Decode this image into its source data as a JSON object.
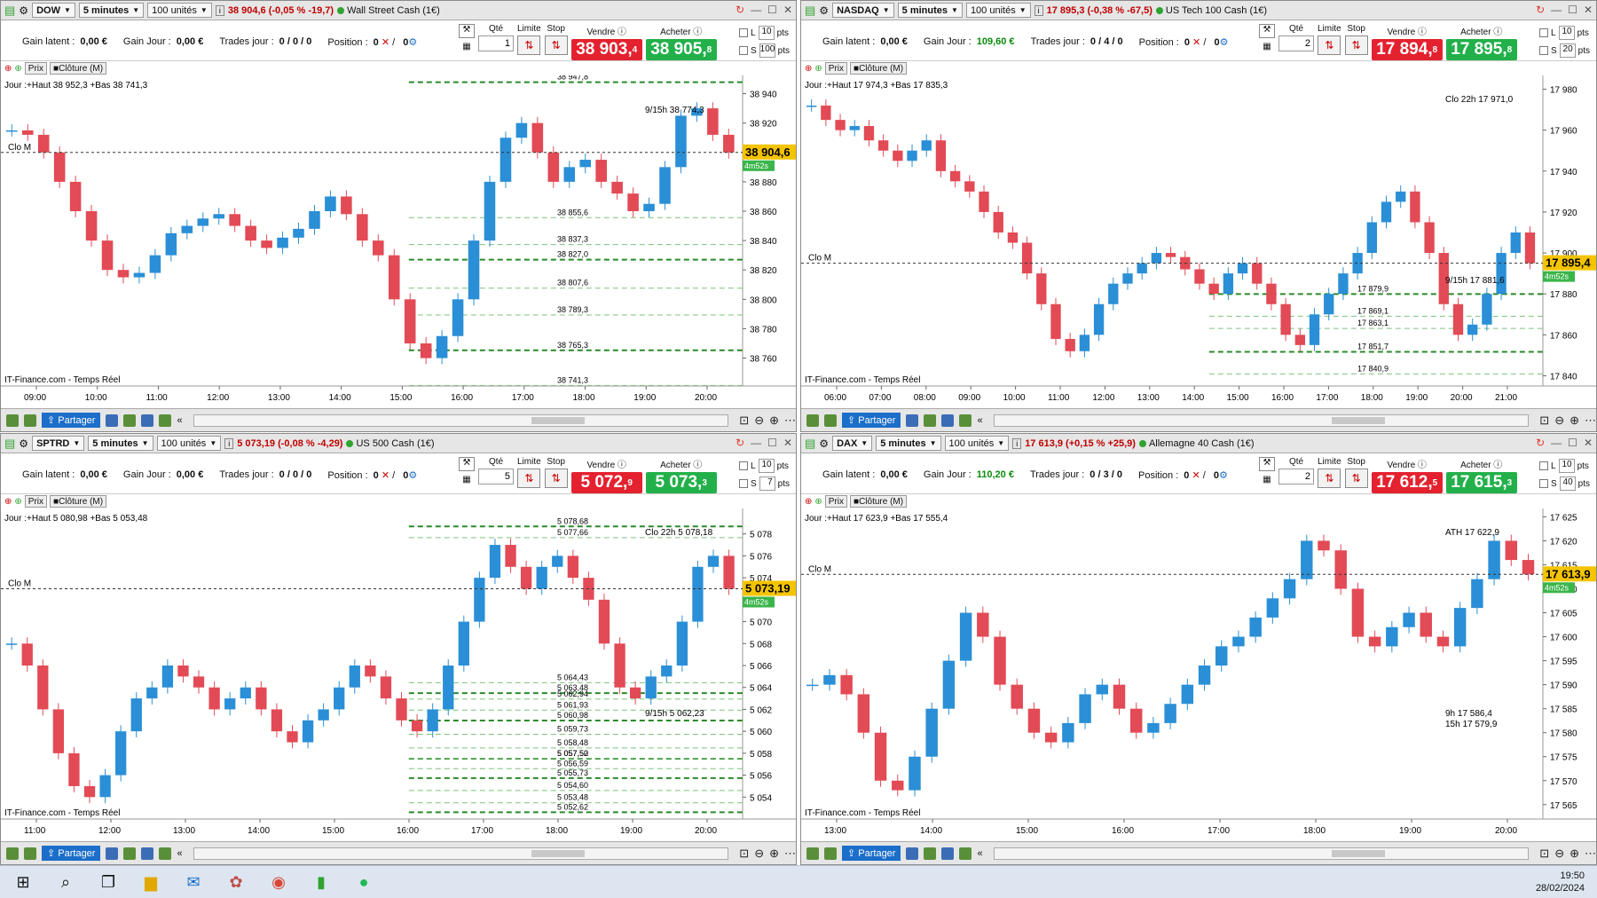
{
  "panes": [
    {
      "symbol": "DOW",
      "timeframe": "5 minutes",
      "units": "100 unités",
      "quote": "38 904,6 (-0,05 % -19,7)",
      "instrument": "Wall Street Cash (1€)",
      "gain_latent_label": "Gain latent :",
      "gain_latent": "0,00 €",
      "gain_jour_label": "Gain Jour :",
      "gain_jour": "0,00 €",
      "trades_label": "Trades jour :",
      "trades": "0 / 0 / 0",
      "position_label": "Position :",
      "position": "0",
      "position_b": "0",
      "qty_label": "Qté",
      "qty": "1",
      "limit_label": "Limite",
      "stop_label": "Stop",
      "sell_label": "Vendre",
      "buy_label": "Acheter",
      "sell_big": "38 903,",
      "sell_small": "4",
      "buy_big": "38 905,",
      "buy_small": "8",
      "l_val": "10",
      "s_val": "100",
      "pts": "pts",
      "tb_price": "Prix",
      "tb_close": "Clôture (M)",
      "day_box": "Jour :+Haut 38 952,3 +Bas 38 741,3",
      "chart_data": {
        "type": "candlestick",
        "ylim": [
          38741,
          38950
        ],
        "yticks": [
          "38 940",
          "38 920",
          "38 900",
          "38 880",
          "38 860",
          "38 840",
          "38 820",
          "38 800",
          "38 780",
          "38 760"
        ],
        "xticks": [
          "09:00",
          "10:00",
          "11:00",
          "12:00",
          "13:00",
          "14:00",
          "15:00",
          "16:00",
          "17:00",
          "18:00",
          "19:00",
          "20:00"
        ],
        "last_price": "38 904,6",
        "timer": "4m52s",
        "levels": [
          "38 947,8",
          "38 855,6",
          "38 837,3",
          "38 827,0",
          "38 807,6",
          "38 789,3",
          "38 765,3",
          "38 741,3"
        ],
        "annotations": [
          "Clo M",
          "9/15h 38 774,3",
          "IT-Finance.com - Temps Réel"
        ],
        "close_series": [
          38915,
          38912,
          38900,
          38880,
          38860,
          38840,
          38820,
          38815,
          38818,
          38830,
          38845,
          38850,
          38855,
          38858,
          38850,
          38840,
          38835,
          38842,
          38848,
          38860,
          38870,
          38858,
          38840,
          38830,
          38800,
          38770,
          38760,
          38775,
          38800,
          38840,
          38880,
          38910,
          38920,
          38900,
          38880,
          38890,
          38895,
          38880,
          38872,
          38860,
          38865,
          38890,
          38925,
          38930,
          38912,
          38900
        ]
      }
    },
    {
      "symbol": "NASDAQ",
      "timeframe": "5 minutes",
      "units": "100 unités",
      "quote": "17 895,3 (-0,38 % -67,5)",
      "instrument": "US Tech 100 Cash (1€)",
      "gain_latent_label": "Gain latent :",
      "gain_latent": "0,00 €",
      "gain_jour_label": "Gain Jour :",
      "gain_jour": "109,60 €",
      "trades_label": "Trades jour :",
      "trades": "0 / 4 / 0",
      "position_label": "Position :",
      "position": "0",
      "position_b": "0",
      "qty_label": "Qté",
      "qty": "2",
      "limit_label": "Limite",
      "stop_label": "Stop",
      "sell_label": "Vendre",
      "buy_label": "Acheter",
      "sell_big": "17 894,",
      "sell_small": "8",
      "buy_big": "17 895,",
      "buy_small": "8",
      "l_val": "10",
      "s_val": "20",
      "pts": "pts",
      "tb_price": "Prix",
      "tb_close": "Clôture (M)",
      "day_box": "Jour :+Haut 17 974,3 +Bas 17 835,3",
      "chart_data": {
        "type": "candlestick",
        "ylim": [
          17835,
          17985
        ],
        "yticks": [
          "17 980",
          "17 960",
          "17 940",
          "17 920",
          "17 900",
          "17 880",
          "17 860",
          "17 840"
        ],
        "xticks": [
          "06:00",
          "07:00",
          "08:00",
          "09:00",
          "10:00",
          "11:00",
          "12:00",
          "13:00",
          "14:00",
          "15:00",
          "16:00",
          "17:00",
          "18:00",
          "19:00",
          "20:00",
          "21:00"
        ],
        "last_price": "17 895,4",
        "timer": "4m52s",
        "levels": [
          "17 879,9",
          "17 869,1",
          "17 863,1",
          "17 851,7",
          "17 840,9"
        ],
        "annotations": [
          "Clo 22h 17 971,0",
          "Clo M",
          "9/15h 17 881,6",
          "IT-Finance.com - Temps Réel"
        ],
        "close_series": [
          17972,
          17965,
          17960,
          17962,
          17955,
          17950,
          17945,
          17950,
          17955,
          17940,
          17935,
          17930,
          17920,
          17910,
          17905,
          17890,
          17875,
          17858,
          17852,
          17860,
          17875,
          17885,
          17890,
          17895,
          17900,
          17898,
          17892,
          17885,
          17880,
          17890,
          17895,
          17885,
          17875,
          17860,
          17855,
          17870,
          17880,
          17890,
          17900,
          17915,
          17925,
          17930,
          17915,
          17900,
          17875,
          17860,
          17865,
          17880,
          17900,
          17910,
          17895
        ]
      }
    },
    {
      "symbol": "SPTRD",
      "timeframe": "5 minutes",
      "units": "100 unités",
      "quote": "5 073,19 (-0,08 % -4,29)",
      "instrument": "US 500 Cash (1€)",
      "gain_latent_label": "Gain latent :",
      "gain_latent": "0,00 €",
      "gain_jour_label": "Gain Jour :",
      "gain_jour": "0,00 €",
      "trades_label": "Trades jour :",
      "trades": "0 / 0 / 0",
      "position_label": "Position :",
      "position": "0",
      "position_b": "0",
      "qty_label": "Qté",
      "qty": "5",
      "limit_label": "Limite",
      "stop_label": "Stop",
      "sell_label": "Vendre",
      "buy_label": "Acheter",
      "sell_big": "5 072,",
      "sell_small": "9",
      "buy_big": "5 073,",
      "buy_small": "3",
      "l_val": "10",
      "s_val": "7",
      "pts": "pts",
      "tb_price": "Prix",
      "tb_close": "Clôture (M)",
      "day_box": "Jour :+Haut 5 080,98 +Bas 5 053,48",
      "chart_data": {
        "type": "candlestick",
        "ylim": [
          5052,
          5080
        ],
        "yticks": [
          "5 078",
          "5 076",
          "5 074",
          "5 072",
          "5 070",
          "5 068",
          "5 066",
          "5 064",
          "5 062",
          "5 060",
          "5 058",
          "5 056",
          "5 054"
        ],
        "xticks": [
          "11:00",
          "12:00",
          "13:00",
          "14:00",
          "15:00",
          "16:00",
          "17:00",
          "18:00",
          "19:00",
          "20:00"
        ],
        "last_price": "5 073,19",
        "timer": "4m52s",
        "levels": [
          "5 078,68",
          "5 077,66",
          "5 064,43",
          "5 063,48",
          "5 062,94",
          "5 061,93",
          "5 060,98",
          "5 059,73",
          "5 058,48",
          "5 057,50",
          "5 057,52",
          "5 056,59",
          "5 055,73",
          "5 054,60",
          "5 053,48",
          "5 052,62"
        ],
        "annotations": [
          "Clo 22h 5 078,18",
          "Clo M",
          "9/15h 5 062,23",
          "IT-Finance.com - Temps Réel"
        ],
        "close_series": [
          5068,
          5066,
          5062,
          5058,
          5055,
          5054,
          5056,
          5060,
          5063,
          5064,
          5066,
          5065,
          5064,
          5062,
          5063,
          5064,
          5062,
          5060,
          5059,
          5061,
          5062,
          5064,
          5066,
          5065,
          5063,
          5061,
          5060,
          5062,
          5066,
          5070,
          5074,
          5077,
          5075,
          5073,
          5075,
          5076,
          5074,
          5072,
          5068,
          5064,
          5063,
          5065,
          5066,
          5070,
          5075,
          5076,
          5073
        ]
      }
    },
    {
      "symbol": "DAX",
      "timeframe": "5 minutes",
      "units": "100 unités",
      "quote": "17 613,9 (+0,15 % +25,9)",
      "instrument": "Allemagne 40 Cash (1€)",
      "gain_latent_label": "Gain latent :",
      "gain_latent": "0,00 €",
      "gain_jour_label": "Gain Jour :",
      "gain_jour": "110,20 €",
      "trades_label": "Trades jour :",
      "trades": "0 / 3 / 0",
      "position_label": "Position :",
      "position": "0",
      "position_b": "0",
      "qty_label": "Qté",
      "qty": "2",
      "limit_label": "Limite",
      "stop_label": "Stop",
      "sell_label": "Vendre",
      "buy_label": "Acheter",
      "sell_big": "17 612,",
      "sell_small": "5",
      "buy_big": "17 615,",
      "buy_small": "3",
      "l_val": "10",
      "s_val": "40",
      "pts": "pts",
      "tb_price": "Prix",
      "tb_close": "Clôture (M)",
      "day_box": "Jour :+Haut 17 623,9 +Bas 17 555,4",
      "chart_data": {
        "type": "candlestick",
        "ylim": [
          17562,
          17626
        ],
        "yticks": [
          "17 625",
          "17 620",
          "17 615",
          "17 610",
          "17 605",
          "17 600",
          "17 595",
          "17 590",
          "17 585",
          "17 580",
          "17 575",
          "17 570",
          "17 565"
        ],
        "xticks": [
          "13:00",
          "14:00",
          "15:00",
          "16:00",
          "17:00",
          "18:00",
          "19:00",
          "20:00"
        ],
        "last_price": "17 613,9",
        "timer": "4m52s",
        "levels": [],
        "annotations": [
          "ATH 17 622,9",
          "Clo M",
          "9h 17 586,4",
          "15h 17 579,9",
          "IT-Finance.com - Temps Réel"
        ],
        "close_series": [
          17590,
          17592,
          17588,
          17580,
          17570,
          17568,
          17575,
          17585,
          17595,
          17605,
          17600,
          17590,
          17585,
          17580,
          17578,
          17582,
          17588,
          17590,
          17585,
          17580,
          17582,
          17586,
          17590,
          17594,
          17598,
          17600,
          17604,
          17608,
          17612,
          17620,
          17618,
          17610,
          17600,
          17598,
          17602,
          17605,
          17600,
          17598,
          17606,
          17612,
          17620,
          17616,
          17613
        ]
      }
    }
  ],
  "taskbar": {
    "time": "19:50",
    "date": "28/02/2024"
  }
}
